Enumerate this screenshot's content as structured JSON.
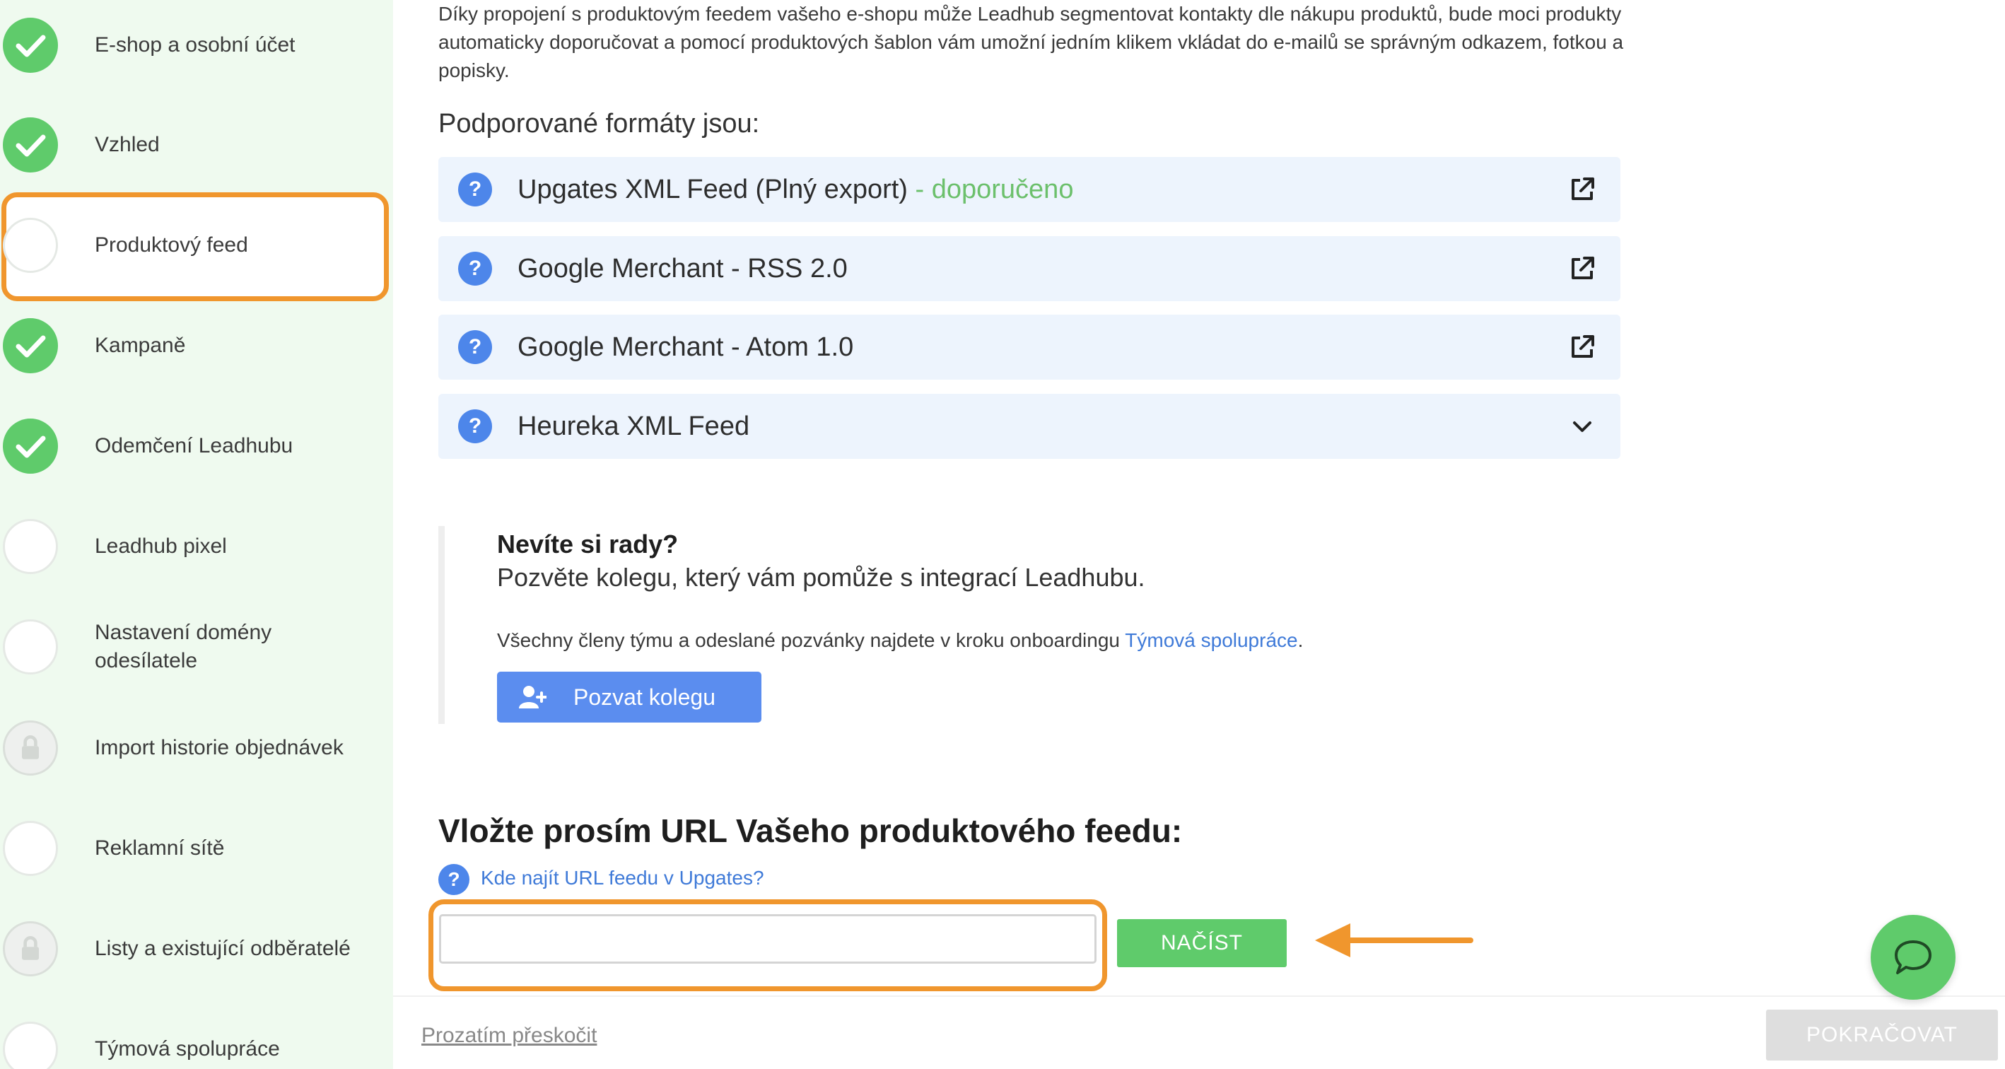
{
  "sidebar": {
    "items": [
      {
        "label": "E-shop a osobní účet",
        "state": "done"
      },
      {
        "label": "Vzhled",
        "state": "done"
      },
      {
        "label": "Produktový feed",
        "state": "active"
      },
      {
        "label": "Kampaně",
        "state": "done"
      },
      {
        "label": "Odemčení Leadhubu",
        "state": "done"
      },
      {
        "label": "Leadhub pixel",
        "state": "todo"
      },
      {
        "label": "Nastavení domény odesílatele",
        "state": "todo"
      },
      {
        "label": "Import historie objednávek",
        "state": "locked"
      },
      {
        "label": "Reklamní sítě",
        "state": "todo"
      },
      {
        "label": "Listy a existující odběratelé",
        "state": "locked"
      },
      {
        "label": "Týmová spolupráce",
        "state": "todo"
      }
    ]
  },
  "main": {
    "intro": "Díky propojení s produktovým feedem vašeho e-shopu může Leadhub segmentovat kontakty dle nákupu produktů, bude moci produkty automaticky doporučovat a pomocí produktových šablon vám umožní jedním klikem vkládat do e-mailů se správným odkazem, fotkou a popisky.",
    "formats_title": "Podporované formáty jsou:",
    "formats": [
      {
        "name": "Upgates XML Feed (Plný export)",
        "note": " - doporučeno",
        "icon": "external-link-icon"
      },
      {
        "name": "Google Merchant - RSS 2.0",
        "note": "",
        "icon": "external-link-icon"
      },
      {
        "name": "Google Merchant - Atom 1.0",
        "note": "",
        "icon": "external-link-icon"
      },
      {
        "name": "Heureka XML Feed",
        "note": "",
        "icon": "chevron-down-icon"
      }
    ],
    "tip": {
      "title": "Nevíte si rady?",
      "subtitle": "Pozvěte kolegu, který vám pomůže s integrací Leadhubu.",
      "note_prefix": "Všechny členy týmu a odeslané pozvánky najdete v kroku onboardingu ",
      "note_link": "Týmová spolupráce",
      "note_suffix": ".",
      "button_label": "Pozvat kolegu"
    },
    "url_section": {
      "title": "Vložte prosím URL Vašeho produktového feedu:",
      "help_link": "Kde najít URL feedu v Upgates?",
      "input_value": "",
      "load_button": "NAČÍST"
    }
  },
  "bottombar": {
    "skip": "Prozatím přeskočit",
    "continue": "POKRAČOVAT"
  },
  "colors": {
    "accent_green": "#5fcb6b",
    "accent_blue": "#4d86ea",
    "highlight_orange": "#f0962d",
    "sidebar_bg": "#effaef"
  }
}
